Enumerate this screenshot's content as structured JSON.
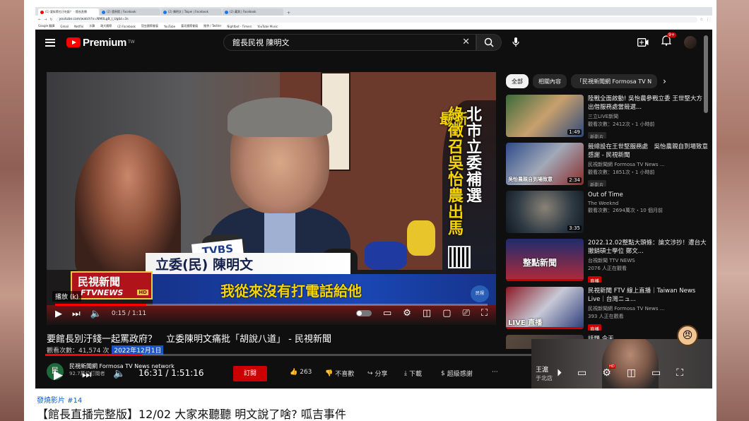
{
  "browser": {
    "tabs": [
      {
        "label": "(1) 要挨罵也汙吃飯？ - 館長直播"
      },
      {
        "label": "(2) 還原館 | Facebook"
      },
      {
        "label": "(2) 陳明文 | Taipei | Facebook"
      },
      {
        "label": "(2) 藏洞 | Facebook"
      }
    ],
    "new_tab": "+",
    "url": "youtube.com/watch?v=NM0LgB_l_Ug&t=3s",
    "bookmarks": [
      "Google 翻譯",
      "Gmail",
      "Netflix",
      "水蘋",
      "政大國際",
      "(2) Facebook",
      "昆虫國際會展",
      "YouTube",
      "臺北國際會展",
      "推特 / Twitter",
      "Nightbot - Timers",
      "YouTube Music"
    ]
  },
  "yt": {
    "logo_text": "Premium",
    "logo_tw": "TW",
    "search_value": "館長民視 陳明文",
    "notif_count": "9+"
  },
  "video": {
    "new_label": "最新",
    "banner_white": "北市立委補選",
    "banner_yellow": "綠徵召吳怡農出馬",
    "news_logo_cn": "民視新聞",
    "news_logo_en": "FTVNEWS",
    "news_logo_hd": "HD",
    "name_strip": "立委(民) 陳明文",
    "tvbs": "TVBS",
    "caption": "我從來沒有打電話給他",
    "ftv_side": "民視",
    "playback_chip": "播放 (k)",
    "time_current": "0:15",
    "time_total": "1:11",
    "progress_fraction": 0.21
  },
  "below": {
    "title": "要館長別汙錢一起罵政府？　立委陳明文痛批「胡說八道」 - 民視新聞",
    "views": "觀看次數：41,574 次",
    "date": "2022年12月1日",
    "channel_name": "民視新聞網 Formosa TV News network",
    "subs": "92.7萬位訂閱者",
    "subscribe": "訂閱",
    "likes": "263",
    "dislike": "不喜歡",
    "share": "分享",
    "download": "下載",
    "thanks": "超級感謝",
    "more": "···",
    "stream_time": "16:31 / 1:51:16",
    "stream_progress": 0.148,
    "pip_label": "王滬",
    "pip_label2": "于北店"
  },
  "sidebar": {
    "chips": [
      "全部",
      "相關內容",
      "「民視新聞網 Formosa TV N"
    ],
    "items": [
      {
        "title": "陸戰全面啟動! 吳怡農參戰立委 王世堅大方出借服務處當競選...",
        "channel": "三立LIVE新聞",
        "meta": "觀看次數：2412次・1 小時前",
        "badge": "新影片",
        "duration": "1:49",
        "thumb_text": ""
      },
      {
        "title": "競總設在王世堅服務處　吳怡農親自到場致意感謝 - 民視新聞",
        "channel": "民視新聞網 Formosa TV News ...",
        "meta": "觀看次數：1851次・1 小時前",
        "badge": "新影片",
        "duration": "2:34",
        "thumb_text": "吳怡農親自到場致意"
      },
      {
        "title": "Out of Time",
        "channel": "The Weeknd",
        "meta": "觀看次數：2694萬次・10 個月前",
        "badge": "",
        "duration": "3:35",
        "thumb_text": ""
      },
      {
        "title": "2022.12.02整點大頭條：論文涉抄！遭台大撤銷碩士學位 鄭文...",
        "channel": "台視新聞 TTV NEWS",
        "meta": "2076 人正在觀看",
        "badge": "直播",
        "duration": "",
        "thumb_text": "整點新聞"
      },
      {
        "title": "民視新聞 FTV 線上直播｜Taiwan News Live｜台灣ニュ...",
        "channel": "民視新聞網 Formosa TV News ...",
        "meta": "393 人正在觀看",
        "badge": "直播",
        "duration": "",
        "thumb_text": "LIVE 直播"
      },
      {
        "title": "話題 今天...",
        "channel": "",
        "meta": "",
        "badge": "",
        "duration": "",
        "thumb_text": ""
      }
    ]
  },
  "page": {
    "chapter": "發燒影片 #14",
    "title": "【館長直播完整版】12/02 大家來聽聽 明文說了啥? 呱吉事件"
  },
  "colors": {
    "yt_red": "#ff0000",
    "bg_dark": "#0f0f0f",
    "caption_blue": "#1a47b5",
    "caption_yellow": "#f5d400",
    "link_blue": "#065fd4"
  }
}
